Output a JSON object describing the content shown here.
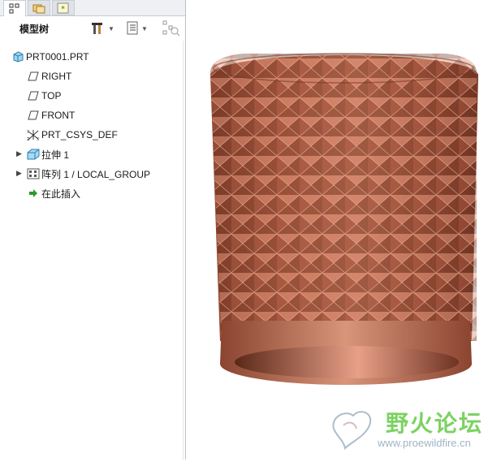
{
  "panel": {
    "tabs": [
      {
        "name": "model-tree-tab-icon",
        "active": true
      },
      {
        "name": "folder-browser-tab-icon",
        "active": false
      },
      {
        "name": "favorites-tab-icon",
        "active": false
      }
    ],
    "title": "模型树"
  },
  "tree": {
    "root": {
      "label": "PRT0001.PRT",
      "icon": "part-icon"
    },
    "items": [
      {
        "label": "RIGHT",
        "icon": "datum-plane-icon"
      },
      {
        "label": "TOP",
        "icon": "datum-plane-icon"
      },
      {
        "label": "FRONT",
        "icon": "datum-plane-icon"
      },
      {
        "label": "PRT_CSYS_DEF",
        "icon": "csys-icon"
      },
      {
        "label": "拉伸 1",
        "icon": "extrude-icon",
        "expandable": true
      },
      {
        "label": "阵列 1 / LOCAL_GROUP",
        "icon": "pattern-icon",
        "expandable": true
      },
      {
        "label": "在此插入",
        "icon": "insert-here-icon"
      }
    ]
  },
  "watermark": {
    "title": "野火论坛",
    "url": "www.proewildfire.cn"
  },
  "colors": {
    "model": "#b8654a",
    "model_dark": "#6e3322",
    "model_light": "#f0b09a",
    "watermark_green": "#5cc83c"
  }
}
